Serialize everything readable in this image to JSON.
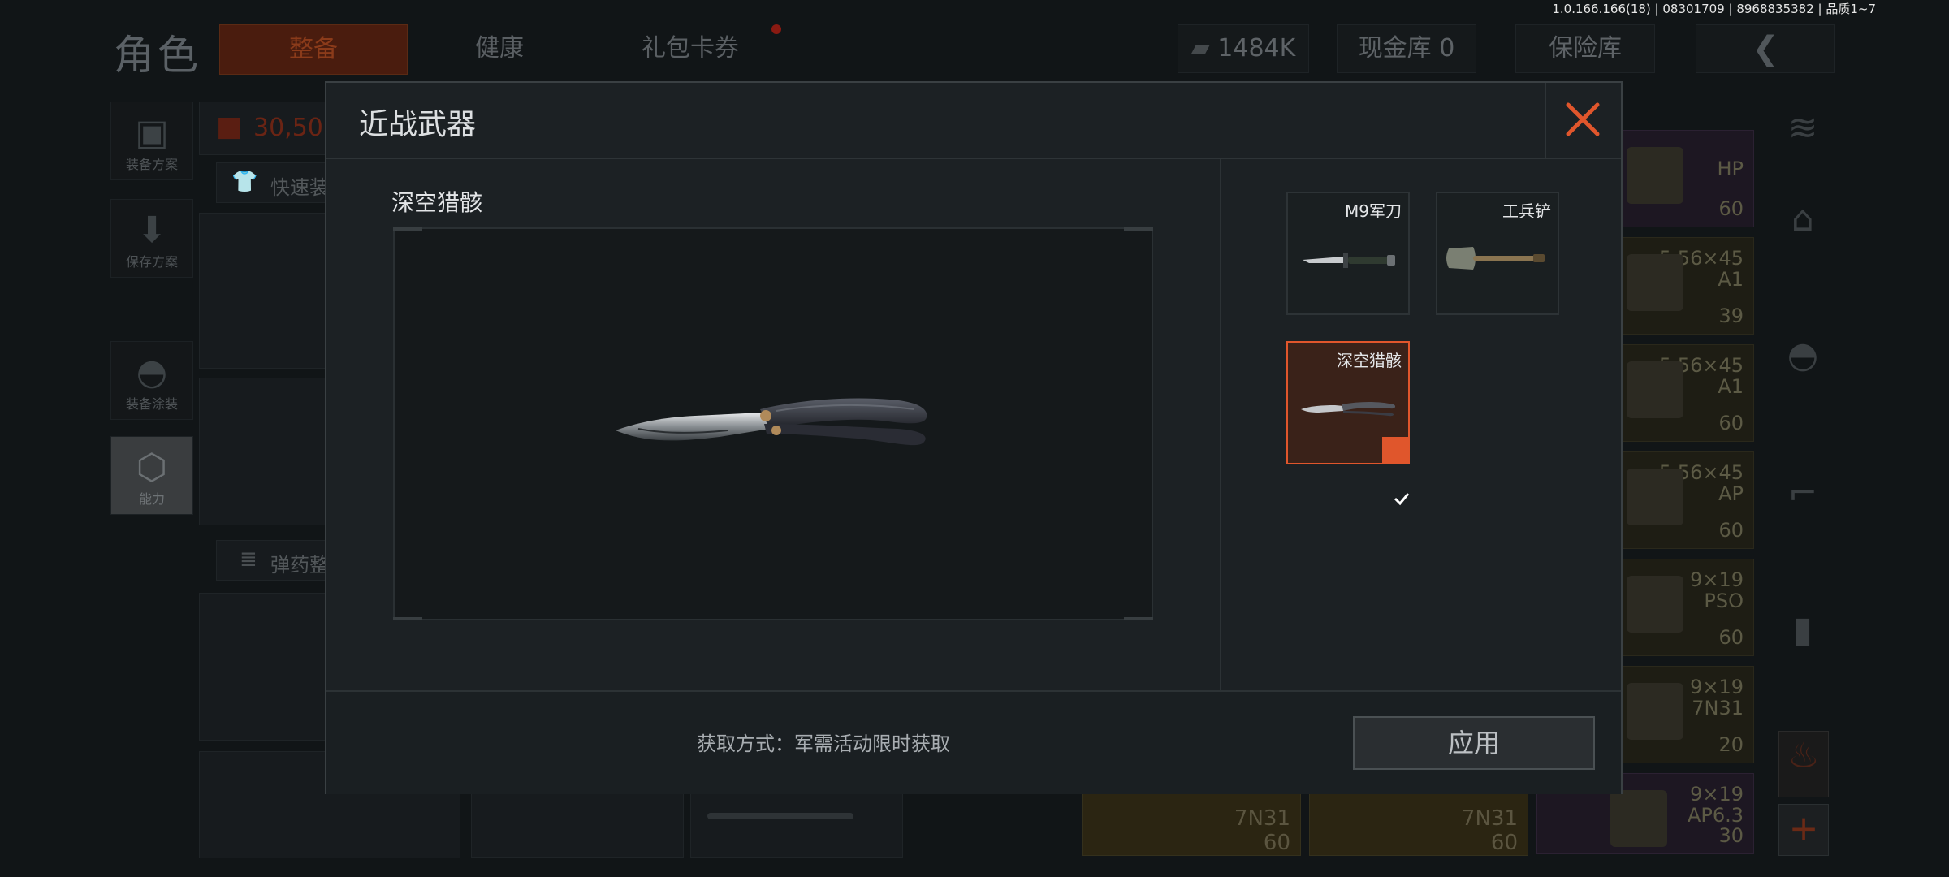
{
  "version_text": "1.0.166.166(18) | 08301709 | 8968835382 | 品质1~7",
  "background": {
    "title": "角色",
    "tabs": [
      {
        "label": "整备",
        "active": true
      },
      {
        "label": "健康",
        "active": false
      },
      {
        "label": "礼包卡券",
        "active": false
      }
    ],
    "currency": "1484K",
    "cash_vault": "现金库 0",
    "insurance": "保险库",
    "value_display": "30,50",
    "quick_equip": "快速装",
    "ammo_sort": "弹药整",
    "left_menu": [
      {
        "label": "装备方案",
        "icon": "vest-icon"
      },
      {
        "label": "保存方案",
        "icon": "download-icon"
      },
      {
        "label": "装备涂装",
        "icon": "helmet-icon"
      },
      {
        "label": "能力",
        "icon": "ability-icon"
      }
    ],
    "ammo_cards": [
      {
        "lines": [
          "HP"
        ],
        "count": "60",
        "color": "purple"
      },
      {
        "lines": [
          "5.56×45",
          "A1"
        ],
        "count": "39",
        "color": "yellow"
      },
      {
        "lines": [
          "5.56×45",
          "A1"
        ],
        "count": "60",
        "color": "yellow"
      },
      {
        "lines": [
          "5.56×45",
          "AP"
        ],
        "count": "60",
        "color": "yellow"
      },
      {
        "lines": [
          "9×19",
          "PSO"
        ],
        "count": "60",
        "color": "yellow"
      },
      {
        "lines": [
          "9×19",
          "7N31"
        ],
        "count": "20",
        "color": "yellow"
      },
      {
        "lines": [
          "9×19",
          "AP6.3"
        ],
        "count": "30",
        "color": "purple"
      }
    ],
    "bottom_ammo": [
      {
        "lines": [
          "7N31"
        ],
        "count": "60"
      },
      {
        "lines": [
          "7N31"
        ],
        "count": "60"
      }
    ]
  },
  "dialog": {
    "title": "近战武器",
    "selected_name": "深空猎骸",
    "acquisition": "获取方式：军需活动限时获取",
    "apply_label": "应用",
    "items": [
      {
        "name": "M9军刀",
        "icon": "bayonet-icon",
        "selected": false
      },
      {
        "name": "工兵铲",
        "icon": "shovel-icon",
        "selected": false
      },
      {
        "name": "深空猎骸",
        "icon": "butterfly-knife-icon",
        "selected": true
      }
    ]
  },
  "colors": {
    "accent": "#e0562c",
    "panel": "#1c2124"
  }
}
